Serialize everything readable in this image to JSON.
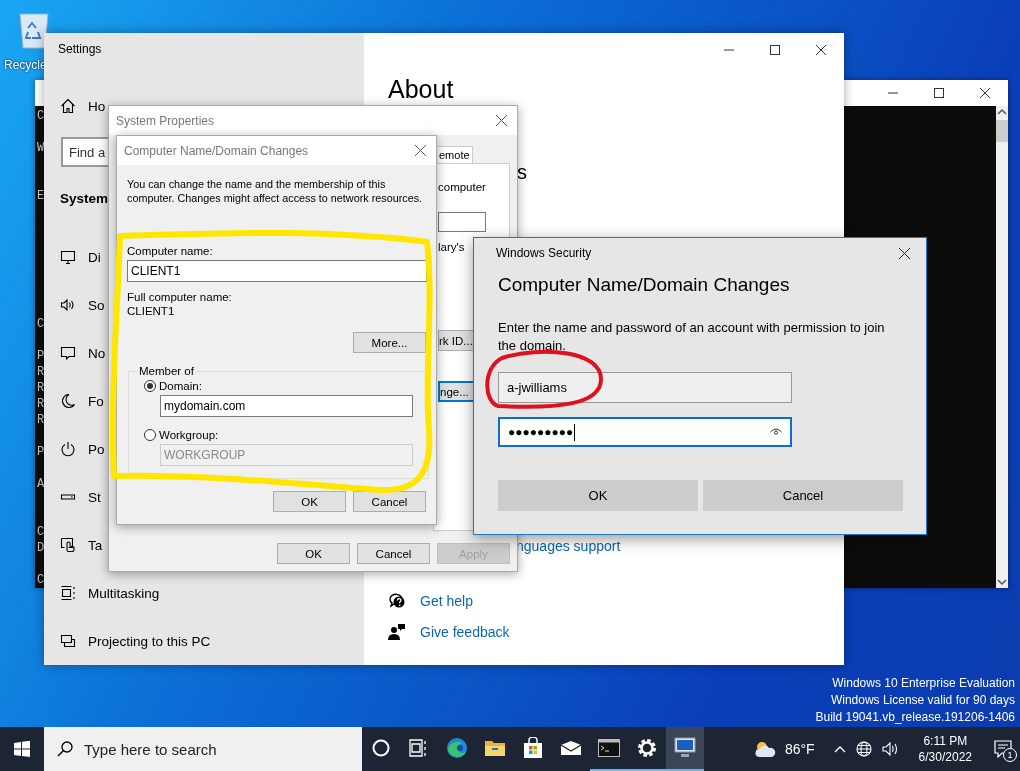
{
  "desktop": {
    "recycle_bin": {
      "label": "Recycle"
    },
    "license_text": [
      "Windows 10 Enterprise Evaluation",
      "Windows License valid for 90 days",
      "Build 19041.vb_release.191206-1406"
    ]
  },
  "console_window": {
    "line_blocks": [
      [
        "C"
      ],
      [
        "W"
      ],
      [
        "E"
      ],
      [
        "C"
      ],
      [
        "P",
        "R",
        "R",
        "R",
        "R"
      ],
      [
        "P"
      ],
      [
        "A"
      ],
      [
        "C",
        "D"
      ],
      [
        "C"
      ]
    ]
  },
  "settings_window": {
    "title": "Settings",
    "sidebar": {
      "home": "Ho",
      "search": {
        "placeholder": "Find a"
      },
      "section": "System",
      "items": [
        {
          "label": "Di"
        },
        {
          "label": "So"
        },
        {
          "label": "No"
        },
        {
          "label": "Fo"
        },
        {
          "label": "Po"
        },
        {
          "label": "St"
        },
        {
          "label": "Ta"
        },
        {
          "label": "Multitasking"
        },
        {
          "label": "Projecting to this PC"
        }
      ]
    },
    "content": {
      "heading": "About",
      "subheading": "s",
      "link": "nguages support",
      "help_links": [
        {
          "label": "Get help"
        },
        {
          "label": "Give feedback"
        }
      ]
    }
  },
  "system_properties": {
    "title": "System Properties",
    "tab": "emote",
    "panel_texts": [
      "computer",
      "lary's"
    ],
    "panel_buttons": [
      {
        "label": "rk ID...",
        "focused": false
      },
      {
        "label": "nge...",
        "focused": true
      }
    ],
    "buttons": [
      {
        "label": "OK",
        "disabled": false
      },
      {
        "label": "Cancel",
        "disabled": false
      },
      {
        "label": "Apply",
        "disabled": true
      }
    ]
  },
  "name_dialog": {
    "title": "Computer Name/Domain Changes",
    "description": "You can change the name and the membership of this computer. Changes might affect access to network resources.",
    "computer_name_label": "Computer name:",
    "computer_name": "CLIENT1",
    "full_name_label": "Full computer name:",
    "full_name": "CLIENT1",
    "more_button": "More...",
    "member_of": "Member of",
    "options": [
      {
        "label": "Domain:",
        "selected": true,
        "value": "mydomain.com"
      },
      {
        "label": "Workgroup:",
        "selected": false,
        "value": "WORKGROUP"
      }
    ],
    "buttons": [
      "OK",
      "Cancel"
    ]
  },
  "security_dialog": {
    "title": "Windows Security",
    "heading": "Computer Name/Domain Changes",
    "message": "Enter the name and password of an account with permission to join the domain.",
    "username": "a-jwilliams",
    "password": "●●●●●●●●●",
    "buttons": [
      "OK",
      "Cancel"
    ]
  },
  "annotations": [
    {
      "color": "#ffe600"
    },
    {
      "color": "#e0101c"
    }
  ],
  "taskbar": {
    "search_placeholder": "Type here to search",
    "apps": [
      {
        "running": false,
        "selected": false
      },
      {
        "running": false,
        "selected": false
      },
      {
        "running": false,
        "selected": false
      },
      {
        "running": false,
        "selected": false
      },
      {
        "running": false,
        "selected": false
      },
      {
        "running": false,
        "selected": false
      },
      {
        "running": true,
        "selected": false
      },
      {
        "running": true,
        "selected": false
      },
      {
        "running": true,
        "selected": true
      }
    ],
    "weather": "86°F",
    "time": "6:11 PM",
    "date": "6/30/2022",
    "notification_count": "1"
  }
}
